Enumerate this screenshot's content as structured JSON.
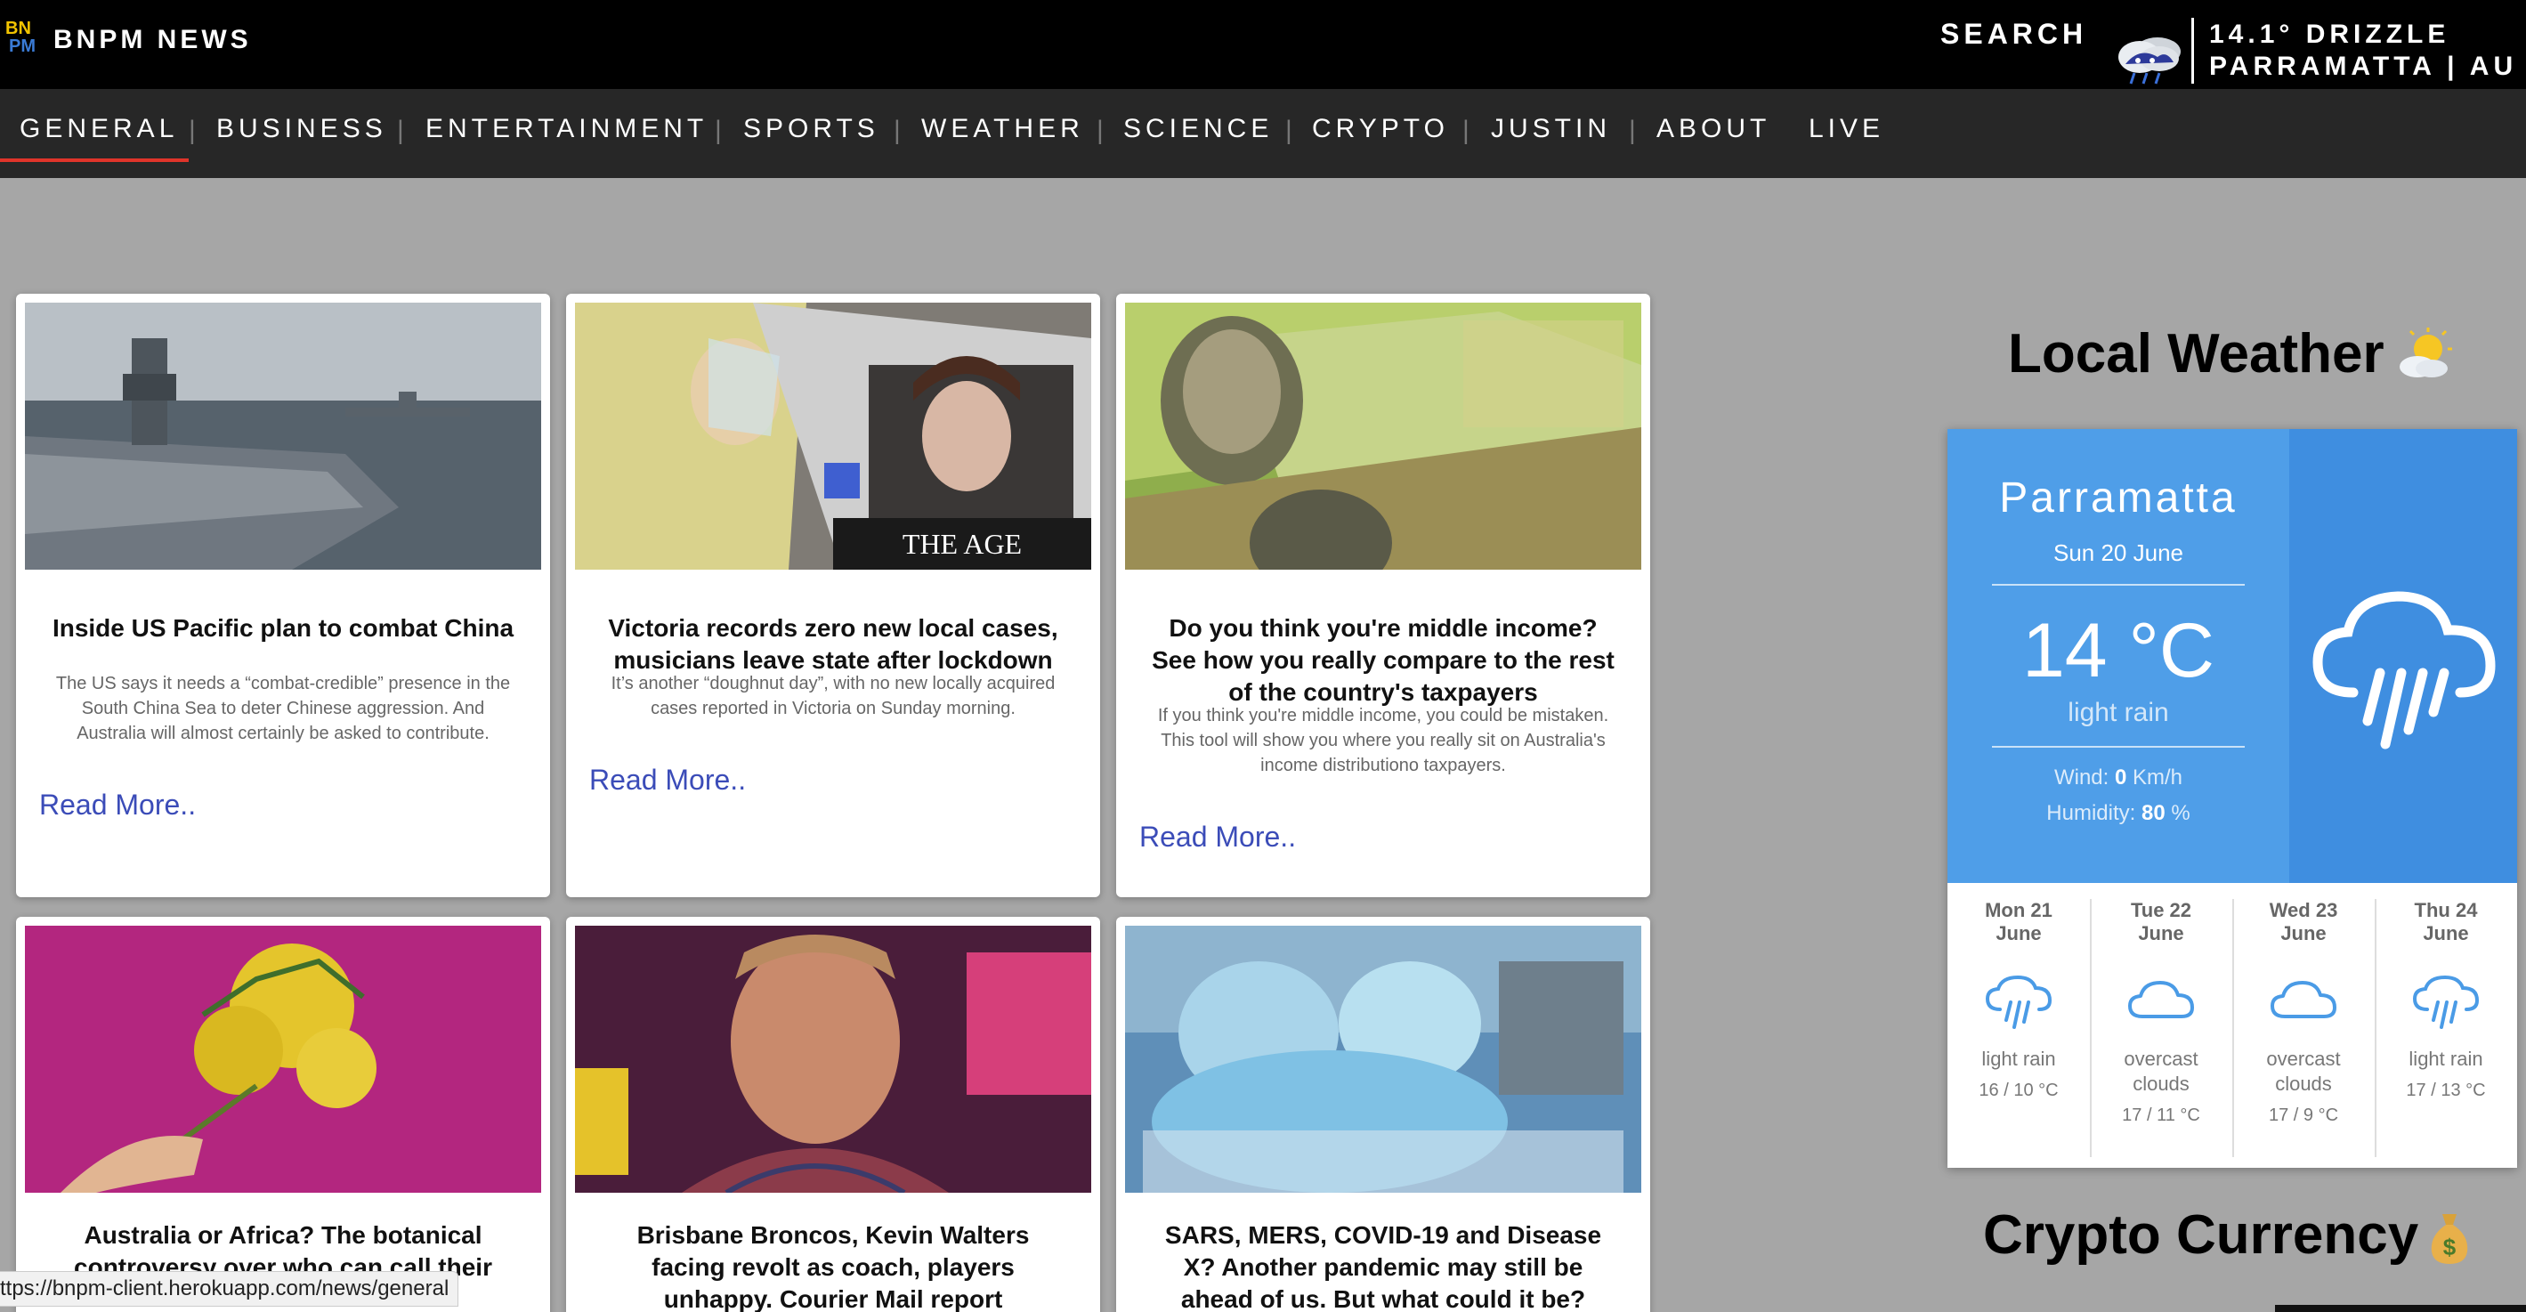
{
  "header": {
    "brand": "BNPM NEWS",
    "search_label": "SEARCH",
    "weather_line1": "14.1° DRIZZLE",
    "weather_line2": "PARRAMATTA | AU"
  },
  "nav": {
    "items": [
      "GENERAL",
      "BUSINESS",
      "ENTERTAINMENT",
      "SPORTS",
      "WEATHER",
      "SCIENCE",
      "CRYPTO",
      "JUSTIN",
      "ABOUT",
      "LIVE"
    ],
    "active": "GENERAL"
  },
  "articles": [
    {
      "title": "Inside US Pacific plan to combat China",
      "description": "The US says it needs a “combat-credible” presence in the South China Sea to deter Chinese aggression. And Australia will almost certainly be asked to contribute.",
      "link": "Read More.."
    },
    {
      "title": "Victoria records zero new local cases, musicians leave state after lockdown",
      "description": "It’s another “doughnut day”, with no new locally acquired cases reported in Victoria on Sunday morning.",
      "link": "Read More..",
      "image_caption": "THE AGE"
    },
    {
      "title": "Do you think you're middle income? See how you really compare to the rest of the country's taxpayers",
      "description": "If you think you're middle income, you could be mistaken. This tool will show you where you really sit on Australia's income distributiono taxpayers.",
      "link": "Read More.."
    },
    {
      "title": "Australia or Africa? The botanical controversy over who can call their"
    },
    {
      "title": "Brisbane Broncos, Kevin Walters facing revolt as coach, players unhappy. Courier Mail report"
    },
    {
      "title": "SARS, MERS, COVID-19 and Disease X? Another pandemic may still be ahead of us. But what could it be?"
    }
  ],
  "weather": {
    "section_title": "Local Weather",
    "city": "Parramatta",
    "date": "Sun 20 June",
    "temp": "14 °C",
    "description": "light rain",
    "wind_label": "Wind: ",
    "wind_value": "0",
    "wind_unit": " Km/h",
    "humidity_label": "Humidity: ",
    "humidity_value": "80",
    "humidity_unit": " %",
    "forecast": [
      {
        "day": "Mon 21",
        "month": "June",
        "desc1": "light rain",
        "desc2": "",
        "range": "16 / 10 °C",
        "icon": "rain-icon"
      },
      {
        "day": "Tue 22",
        "month": "June",
        "desc1": "overcast",
        "desc2": "clouds",
        "range": "17 / 11 °C",
        "icon": "cloud-icon"
      },
      {
        "day": "Wed 23",
        "month": "June",
        "desc1": "overcast",
        "desc2": "clouds",
        "range": "17 / 9 °C",
        "icon": "cloud-icon"
      },
      {
        "day": "Thu 24",
        "month": "June",
        "desc1": "light rain",
        "desc2": "",
        "range": "17 / 13 °C",
        "icon": "rain-icon"
      }
    ]
  },
  "crypto": {
    "section_title": "Crypto Currency"
  },
  "status_url": "ttps://bnpm-client.herokuapp.com/news/general",
  "colors": {
    "accent": "#e0342a",
    "link": "#3b4cb8",
    "weather_blue": "#4f9ee8"
  }
}
